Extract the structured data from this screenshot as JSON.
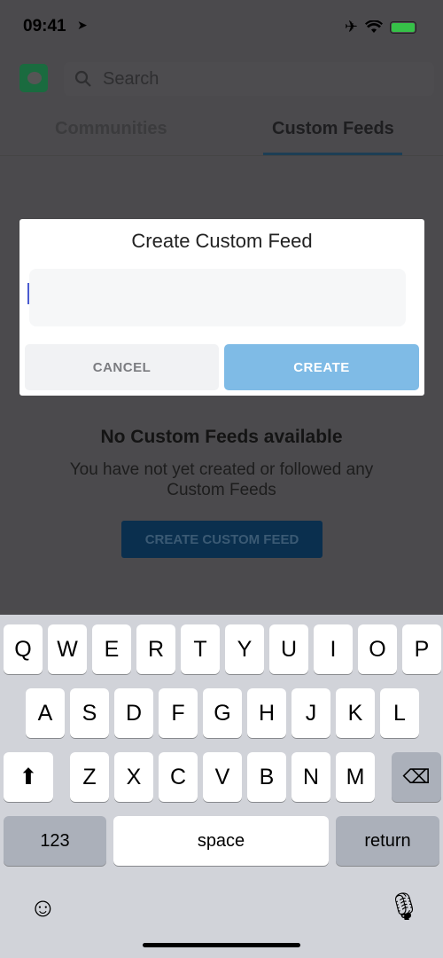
{
  "status": {
    "time": "09:41",
    "location_icon": "location-arrow-icon",
    "icons": [
      "airplane-icon",
      "wifi-icon",
      "battery-charging-icon"
    ],
    "battery_color": "#36c148"
  },
  "header": {
    "search_placeholder": "Search",
    "tabs": [
      {
        "label": "Communities",
        "active": false
      },
      {
        "label": "Custom Feeds",
        "active": true
      }
    ]
  },
  "dialog": {
    "title": "Create Custom Feed",
    "input_value": "",
    "cancel_label": "CANCEL",
    "create_label": "CREATE"
  },
  "empty": {
    "title": "No Custom Feeds available",
    "subtitle": "You have not yet created or followed any Custom Feeds",
    "cta_label": "CREATE CUSTOM FEED"
  },
  "keyboard": {
    "rows": [
      [
        "Q",
        "W",
        "E",
        "R",
        "T",
        "Y",
        "U",
        "I",
        "O",
        "P"
      ],
      [
        "A",
        "S",
        "D",
        "F",
        "G",
        "H",
        "J",
        "K",
        "L"
      ],
      [
        "Z",
        "X",
        "C",
        "V",
        "B",
        "N",
        "M"
      ]
    ],
    "numbers_label": "123",
    "space_label": "space",
    "return_label": "return"
  },
  "colors": {
    "accent": "#7fbbe6",
    "cta": "#0a2f4e"
  }
}
